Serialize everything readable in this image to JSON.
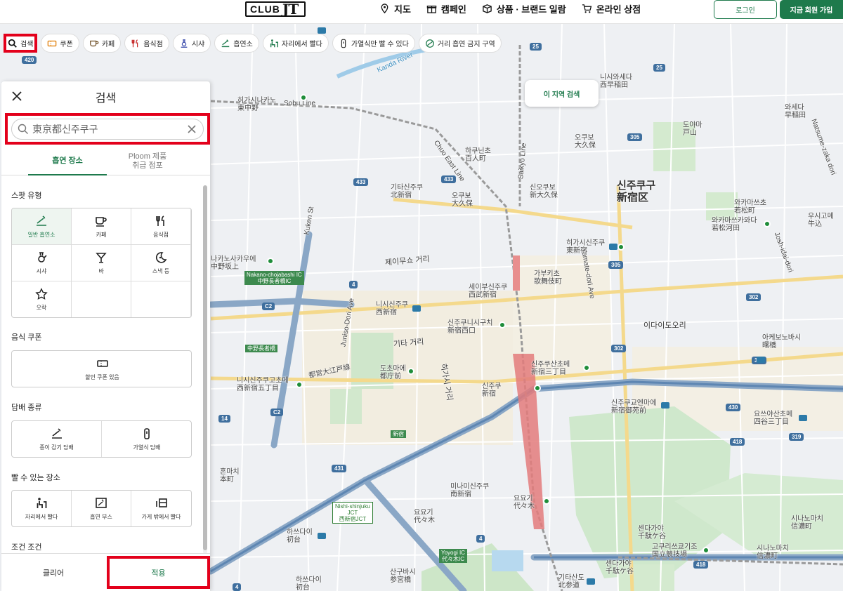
{
  "header": {
    "logo_text": "CLUB",
    "logo_jt": "JT",
    "nav": [
      {
        "label": "지도",
        "icon": "map-pin-icon"
      },
      {
        "label": "캠페인",
        "icon": "gift-icon"
      },
      {
        "label": "상품 · 브랜드 일람",
        "icon": "box-icon"
      },
      {
        "label": "온라인 상점",
        "icon": "cart-icon"
      }
    ],
    "login_label": "로그인",
    "join_label": "지금 회원 가입"
  },
  "chips": [
    {
      "label": "검색",
      "icon": "search-icon"
    },
    {
      "label": "쿠폰",
      "icon": "coupon-icon"
    },
    {
      "label": "카페",
      "icon": "cup-icon"
    },
    {
      "label": "음식점",
      "icon": "fork-knife-icon"
    },
    {
      "label": "시샤",
      "icon": "shisha-icon"
    },
    {
      "label": "흡연소",
      "icon": "smoking-area-icon"
    },
    {
      "label": "자리에서 빨다",
      "icon": "seat-smoke-icon"
    },
    {
      "label": "가열식만 빨 수 있다",
      "icon": "heated-device-icon"
    },
    {
      "label": "거리 흡연 금지 구역",
      "icon": "no-street-smoking-icon"
    }
  ],
  "map": {
    "search_area_label": "이 지역 검색",
    "labels": [
      {
        "text": "신주쿠구",
        "sub": "新宿区",
        "kind": "big"
      },
      {
        "text": "제이무쇼 거리",
        "kind": "mid"
      },
      {
        "text": "히가시나카노",
        "sub": "東中野"
      },
      {
        "text": "오쿠보",
        "sub": "大久保"
      },
      {
        "text": "하쿠닌초",
        "sub": "百人町"
      },
      {
        "text": "기타신주쿠",
        "sub": "北新宿"
      },
      {
        "text": "오쿠보",
        "sub": "大久保"
      },
      {
        "text": "신오쿠보",
        "sub": "新大久保"
      },
      {
        "text": "니시와세다",
        "sub": "西早稲田"
      },
      {
        "text": "와세다",
        "sub": "早稲田"
      },
      {
        "text": "도야마",
        "sub": "戸山"
      },
      {
        "text": "와카마쓰초",
        "sub": "若松町"
      },
      {
        "text": "와카마쓰카와다",
        "sub": "若松河田"
      },
      {
        "text": "우시고메",
        "sub": "牛込"
      },
      {
        "text": "히가시신주쿠",
        "sub": "東新宿"
      },
      {
        "text": "가부키초",
        "sub": "歌舞伎町"
      },
      {
        "text": "세이부신주쿠",
        "sub": "西武新宿"
      },
      {
        "text": "니시신주쿠",
        "sub": "西新宿"
      },
      {
        "text": "신주쿠니시구치",
        "sub": "新宿西口"
      },
      {
        "text": "기타 거리",
        "kind": "mid"
      },
      {
        "text": "도초마에",
        "sub": "都庁前"
      },
      {
        "text": "니시신주쿠고초메",
        "sub": "西新宿五丁目"
      },
      {
        "text": "신주쿠",
        "sub": "新宿"
      },
      {
        "text": "신주쿠산초메",
        "sub": "新宿三丁目"
      },
      {
        "text": "신주쿠교엔마에",
        "sub": "新宿御苑前"
      },
      {
        "text": "요쓰야산초메",
        "sub": "四谷三丁目"
      },
      {
        "text": "이다이도오리",
        "kind": "mid"
      },
      {
        "text": "아케보노바시",
        "sub": "曙橋"
      },
      {
        "text": "나카노사카우에",
        "sub": "中野坂上"
      },
      {
        "text": "혼마치",
        "sub": "本町"
      },
      {
        "text": "미나미신주쿠",
        "sub": "南新宿"
      },
      {
        "text": "요요기",
        "sub": "代々木"
      },
      {
        "text": "요요기",
        "sub": "代々木"
      },
      {
        "text": "하쓰다이",
        "sub": "初台"
      },
      {
        "text": "산구바시",
        "sub": "参宮橋"
      },
      {
        "text": "하쓰다이",
        "sub": "初台"
      },
      {
        "text": "센다가야",
        "sub": "千駄ケ谷"
      },
      {
        "text": "센다가야",
        "sub": "千駄ケ谷"
      },
      {
        "text": "고쿠리쓰쿄기조",
        "sub": "国立競技場"
      },
      {
        "text": "시나노마치",
        "sub": "信濃町"
      },
      {
        "text": "시나노마치",
        "sub": "信濃町"
      },
      {
        "text": "기타산도",
        "sub": "北参道"
      },
      {
        "text": "히가시 거리",
        "kind": "mid"
      },
      {
        "text": "都営大江戸線"
      },
      {
        "text": "Sobu Line"
      },
      {
        "text": "Chuo East Line"
      },
      {
        "text": "Saikyo Line"
      },
      {
        "text": "Kanda River"
      },
      {
        "text": "Kuken St"
      },
      {
        "text": "Junisо-Dori Ave"
      },
      {
        "text": "Yamate-dori Ave"
      },
      {
        "text": "Josh-idai-dori"
      },
      {
        "text": "Natsume-zaka dori"
      }
    ],
    "shields": [
      "25",
      "25",
      "433",
      "433",
      "305",
      "305",
      "302",
      "302",
      "302",
      "4",
      "4",
      "4",
      "C2",
      "C2",
      "14",
      "431",
      "430",
      "319",
      "418",
      "418",
      "420"
    ],
    "green_boxes": [
      {
        "line1": "Nakano-chojabashi IC",
        "line2": "中野長者橋IC"
      },
      {
        "line1": "中野長者橋",
        "line2": ""
      },
      {
        "line1": "Nishi-shinjuku",
        "line2": "JCT",
        "line3": "西新宿JCT"
      },
      {
        "line1": "Yoyogi IC",
        "line2": "代々木IC"
      },
      {
        "line1": "新宿",
        "line2": ""
      }
    ]
  },
  "panel": {
    "title": "검색",
    "search_value": "東京都신주쿠구",
    "tabs": [
      {
        "label": "흡연 장소",
        "active": true
      },
      {
        "label": "Ploom 제품\n취급 점포",
        "active": false
      }
    ],
    "sections": {
      "spot_type": "스팟 유형",
      "food_coupon": "음식 쿠폰",
      "tobacco_type": "담배 종류",
      "smoke_place": "빨 수 있는 장소",
      "conditions": "조건 조건"
    },
    "spot_types": [
      {
        "label": "일반 흡연소",
        "icon": "smoking-area-icon",
        "selected": true
      },
      {
        "label": "카페",
        "icon": "cup-icon",
        "selected": false
      },
      {
        "label": "음식점",
        "icon": "fork-knife-icon",
        "selected": false
      },
      {
        "label": "시샤",
        "icon": "shisha-icon",
        "selected": false
      },
      {
        "label": "바",
        "icon": "cocktail-icon",
        "selected": false
      },
      {
        "label": "스낵 등",
        "icon": "moon-icon",
        "selected": false
      },
      {
        "label": "오락",
        "icon": "star-icon",
        "selected": false
      }
    ],
    "coupon_option": {
      "label": "할인 쿠폰 있음",
      "icon": "coupon-icon"
    },
    "tobacco_types": [
      {
        "label": "종이 감기 담배",
        "icon": "cigarette-icon"
      },
      {
        "label": "가열식 담배",
        "icon": "heated-device-icon"
      }
    ],
    "smoke_places": [
      {
        "label": "자리에서 빨다",
        "icon": "seat-smoke-icon"
      },
      {
        "label": "흡연 부스",
        "icon": "booth-icon"
      },
      {
        "label": "가게 밖에서 빨다",
        "icon": "outside-icon"
      }
    ],
    "clear_label": "클리어",
    "apply_label": "적용"
  },
  "colors": {
    "brand_green": "#1e7a4c",
    "highlight_red": "#e3001b",
    "road_blue": "#3f6f9e"
  }
}
